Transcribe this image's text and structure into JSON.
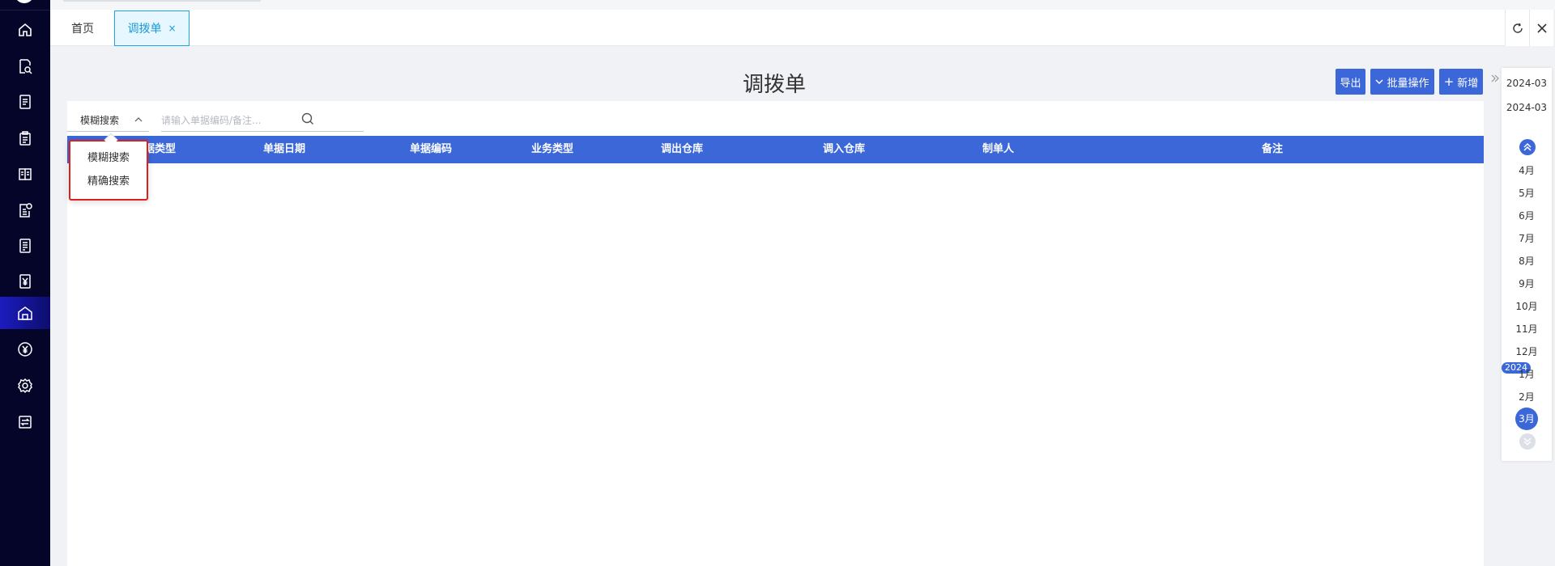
{
  "tabs": [
    {
      "label": "首页"
    },
    {
      "label": "调拨单",
      "close": "×"
    }
  ],
  "page": {
    "title": "调拨单"
  },
  "toolbar": {
    "export_label": "导出",
    "batch_label": "批量操作",
    "add_label": "新增"
  },
  "search": {
    "mode_label": "模糊搜索",
    "placeholder": "请输入单据编码/备注..."
  },
  "dropdown": {
    "options": [
      "模糊搜索",
      "精确搜索"
    ]
  },
  "table": {
    "columns": [
      "单据类型",
      "单据日期",
      "单据编码",
      "业务类型",
      "调出仓库",
      "调入仓库",
      "制单人",
      "备注"
    ],
    "first_column_visible": "据类型"
  },
  "date_panel": {
    "start_date": "2024-03",
    "end_date": "2024-03",
    "months": [
      "4月",
      "5月",
      "6月",
      "7月",
      "8月",
      "9月",
      "10月",
      "11月",
      "12月",
      "1月",
      "2月",
      "3月"
    ],
    "selected_month": "3月",
    "year_badge": "2024"
  },
  "colors": {
    "nav_bg": "#05052a",
    "accent": "#3c67d8",
    "tab_active": "#1c9ad6",
    "highlight_border": "#e02020"
  },
  "icons": [
    "home-icon",
    "search-doc-icon",
    "list-doc-icon",
    "clipboard-icon",
    "ledger-icon",
    "doc-badge-icon",
    "report-icon",
    "yen-doc-icon",
    "warehouse-icon",
    "yen-circle-icon",
    "gear-icon",
    "transfer-icon",
    "refresh-icon",
    "close-icon",
    "search-icon",
    "chevron-up-icon",
    "double-chevron-right-icon",
    "chevron-up-circle-icon",
    "chevron-down-circle-icon"
  ]
}
